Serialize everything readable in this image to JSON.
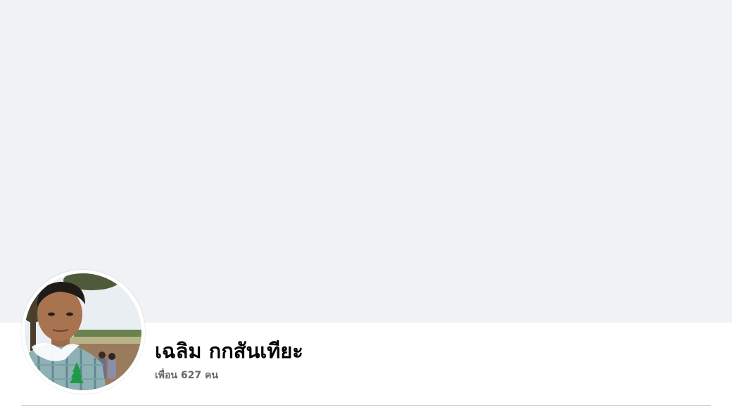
{
  "profile": {
    "name": "เฉลิม กกสันเทียะ",
    "friends_text": "เพื่อน 627 คน"
  },
  "colors": {
    "cover_background": "#f0f2f5",
    "name_text": "#050505",
    "secondary_text": "#65676b",
    "divider": "#ced0d4"
  }
}
